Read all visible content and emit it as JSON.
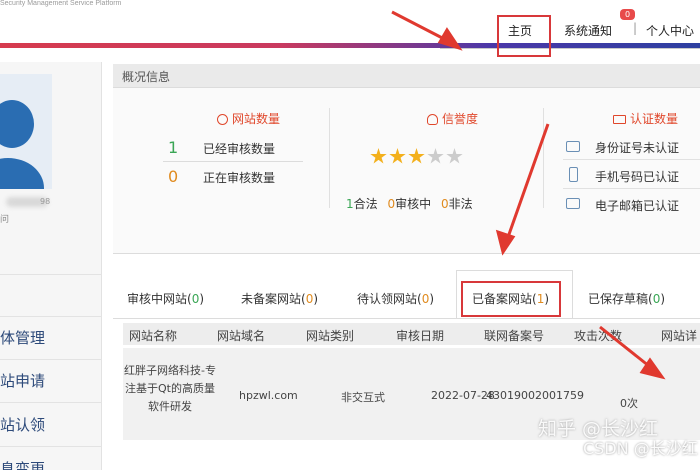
{
  "header": {
    "subtitle": "Security Management Service Platform",
    "nav": {
      "home": "主页",
      "notice": "系统通知",
      "separator": "|",
      "personal": "个人中心"
    },
    "notice_badge": "0"
  },
  "sidebar": {
    "blurred_number": "98",
    "under_text": "问",
    "menu": [
      "主体管理",
      "网站申请",
      "网站认领",
      "信息变更"
    ]
  },
  "overview": {
    "title": "概况信息",
    "site_count": {
      "title": "网站数量",
      "rows": [
        {
          "value": "1",
          "label": "已经审核数量"
        },
        {
          "value": "0",
          "label": "正在审核数量"
        }
      ]
    },
    "credit": {
      "title": "信誉度",
      "stars_total": 5,
      "stars_filled": 3,
      "legal_count": "1",
      "legal_label": "合法",
      "pending_count": "0",
      "pending_label": "审核中",
      "illegal_count": "0",
      "illegal_label": "非法"
    },
    "certification": {
      "title": "认证数量",
      "items": [
        "身份证号未认证",
        "手机号码已认证",
        "电子邮箱已认证"
      ]
    }
  },
  "tabs": [
    {
      "label": "审核中网站",
      "count": "0"
    },
    {
      "label": "未备案网站",
      "count": "0"
    },
    {
      "label": "待认领网站",
      "count": "0"
    },
    {
      "label": "已备案网站",
      "count": "1"
    },
    {
      "label": "已保存草稿",
      "count": "0"
    }
  ],
  "table": {
    "headers": [
      "网站名称",
      "网站域名",
      "网站类别",
      "审核日期",
      "联网备案号",
      "攻击次数",
      "网站详"
    ],
    "rows": [
      {
        "name": "红胖子网络科技-专注基于Qt的高质量软件研发",
        "domain": "hpzwl.com",
        "category": "非交互式",
        "date": "2022-07-28",
        "record_no": "43019002001759",
        "attacks": "0次"
      }
    ]
  },
  "watermark": {
    "line1": "知乎 @长沙红",
    "line2": "CSDN @长沙红"
  },
  "colors": {
    "accent_red": "#d8383a",
    "title_orange": "#e0472b",
    "count_green": "#3aa655",
    "count_orange": "#e08b1f",
    "star_gold": "#f3b01c",
    "star_gray": "#cccccc"
  }
}
